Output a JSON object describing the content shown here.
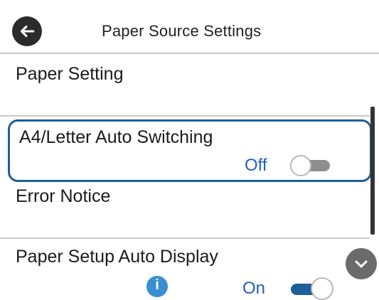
{
  "header": {
    "title": "Paper Source Settings",
    "back_icon": "arrow-left-icon"
  },
  "items": [
    {
      "label": "Paper Setting"
    },
    {
      "label": "A4/Letter Auto Switching",
      "state_text": "Off",
      "toggle": "off",
      "selected": true
    },
    {
      "label": "Error Notice"
    },
    {
      "label": "Paper Setup Auto Display",
      "state_text": "On",
      "toggle": "on",
      "info_icon": "info-icon"
    }
  ],
  "scroll_down_icon": "chevron-down-icon",
  "colors": {
    "accent": "#1f5f9a",
    "state_text": "#1f5fbf",
    "info": "#3a8fd2",
    "divider": "#c9c9c9"
  }
}
